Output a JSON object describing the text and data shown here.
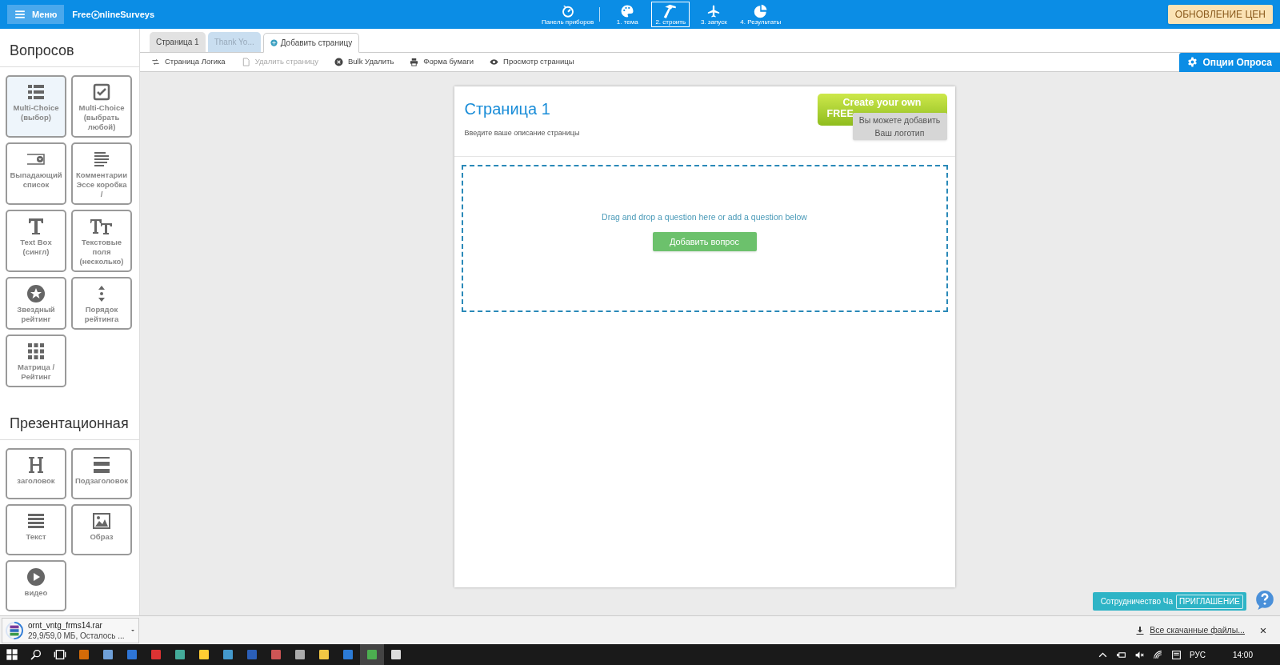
{
  "nav": {
    "menu_label": "Меню",
    "logo_left": "Free",
    "logo_right": "nlineSurveys",
    "steps": [
      {
        "label": "Панель приборов",
        "kind": "dashboard",
        "selected": false
      },
      {
        "label": "1. тема",
        "kind": "palette",
        "selected": false
      },
      {
        "label": "2. строить",
        "kind": "hammer",
        "selected": true
      },
      {
        "label": "3. запуск",
        "kind": "plane",
        "selected": false
      },
      {
        "label": "4. Результаты",
        "kind": "pie",
        "selected": false
      }
    ],
    "upgrade_button": "ОБНОВЛЕНИЕ ЦЕН"
  },
  "tabs": [
    {
      "label": "Страница 1",
      "kind": "page",
      "selected": false
    },
    {
      "label": "Thank Yo...",
      "kind": "thanks",
      "selected": false
    },
    {
      "label": "Добавить страницу",
      "kind": "add",
      "selected": true
    }
  ],
  "toolbar": [
    {
      "label": "Страница Логика",
      "kind": "logic",
      "disabled": false
    },
    {
      "label": "Удалить страницу",
      "kind": "delete",
      "disabled": true
    },
    {
      "label": "Bulk Удалить",
      "kind": "bulk",
      "disabled": false
    },
    {
      "label": "Форма бумаги",
      "kind": "print",
      "disabled": false
    },
    {
      "label": "Просмотр страницы",
      "kind": "eye",
      "disabled": false
    }
  ],
  "options_button": "Опции Опроса",
  "sidebar": [
    {
      "title": "Вопросов",
      "items": [
        {
          "label": "Multi-Choice (выбор)",
          "kind": "list",
          "selected": true
        },
        {
          "label": "Multi-Choice (выбрать любой)",
          "kind": "check",
          "selected": false
        },
        {
          "label": "Выпадающий список",
          "kind": "dropdown",
          "selected": false
        },
        {
          "label": "Комментарии Эссе коробка /",
          "kind": "lines",
          "selected": false
        },
        {
          "label": "Text Box (сингл)",
          "kind": "t",
          "selected": false
        },
        {
          "label": "Текстовые поля (несколько)",
          "kind": "tt",
          "selected": false
        },
        {
          "label": "Звездный рейтинг",
          "kind": "star",
          "selected": false
        },
        {
          "label": "Порядок рейтинга",
          "kind": "order",
          "selected": false
        },
        {
          "label": "Матрица / Рейтинг",
          "kind": "grid",
          "selected": false
        }
      ]
    },
    {
      "title": "Презентационная",
      "items": [
        {
          "label": "заголовок",
          "kind": "h",
          "selected": false
        },
        {
          "label": "Подзаголовок",
          "kind": "hea",
          "selected": false
        },
        {
          "label": "Текст",
          "kind": "text",
          "selected": false
        },
        {
          "label": "Образ",
          "kind": "image",
          "selected": false
        },
        {
          "label": "видео",
          "kind": "video",
          "selected": false
        }
      ]
    }
  ],
  "page": {
    "title": "Страница 1",
    "description": "Введите ваше описание страницы",
    "banner": [
      "Create your own",
      "FREE"
    ],
    "logo_hint": "Вы можете добавить Ваш логотип",
    "drop_text": "Drag and drop a question here or add a question below",
    "add_button": "Добавить вопрос"
  },
  "footer": {
    "collab_label": "Сотрудничество Ча",
    "invite_button": "ПРИГЛАШЕНИЕ"
  },
  "download": {
    "filename": "ornt_vntg_frms14.rar",
    "progress": "29,9/59,0 МБ, Осталось ...",
    "level": 0.51,
    "all_downloads": "Все скачанные файлы..."
  },
  "taskbar": {
    "lang": "РУС",
    "time": "14:00"
  }
}
